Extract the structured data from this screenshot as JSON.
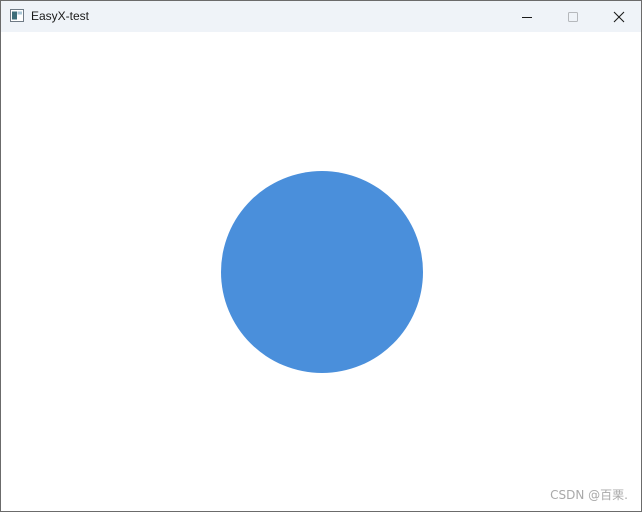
{
  "window": {
    "title": "EasyX-test",
    "icon": "app-window-icon"
  },
  "caption_buttons": {
    "minimize_icon": "minimize-icon",
    "maximize_icon": "maximize-icon",
    "close_icon": "close-icon"
  },
  "canvas": {
    "background": "#ffffff",
    "shape": "circle",
    "fill_color": "#4a8fdb"
  },
  "watermark": {
    "text": "CSDN @百栗."
  }
}
